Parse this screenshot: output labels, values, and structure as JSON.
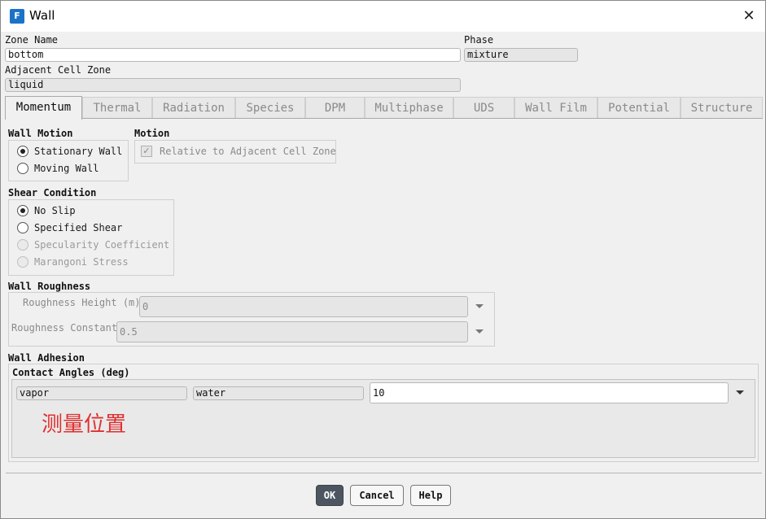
{
  "window": {
    "title": "Wall",
    "app_icon_letter": "F"
  },
  "zone": {
    "zone_name_label": "Zone Name",
    "zone_name_value": "bottom",
    "phase_label": "Phase",
    "phase_value": "mixture",
    "adjacent_label": "Adjacent Cell Zone",
    "adjacent_value": "liquid"
  },
  "tabs": [
    "Momentum",
    "Thermal",
    "Radiation",
    "Species",
    "DPM",
    "Multiphase",
    "UDS",
    "Wall Film",
    "Potential",
    "Structure"
  ],
  "active_tab": "Momentum",
  "wall_motion": {
    "title": "Wall Motion",
    "options": [
      "Stationary Wall",
      "Moving Wall"
    ],
    "selected": "Stationary Wall"
  },
  "motion": {
    "title": "Motion",
    "relative_label": "Relative to Adjacent Cell Zone",
    "relative_checked": true
  },
  "shear": {
    "title": "Shear Condition",
    "options": [
      "No Slip",
      "Specified Shear",
      "Specularity Coefficient",
      "Marangoni Stress"
    ],
    "selected": "No Slip"
  },
  "roughness": {
    "title": "Wall Roughness",
    "height_label": "Roughness Height (m)",
    "height_value": "0",
    "constant_label": "Roughness Constant",
    "constant_value": "0.5"
  },
  "adhesion": {
    "title": "Wall Adhesion",
    "contact_title": "Contact Angles (deg)",
    "phase1": "vapor",
    "phase2": "water",
    "angle_value": "10",
    "annotation": "测量位置"
  },
  "buttons": {
    "ok": "OK",
    "cancel": "Cancel",
    "help": "Help"
  },
  "colors": {
    "accent_icon": "#1a73c9",
    "annotation": "#e03030",
    "primary_button": "#4d5660"
  }
}
